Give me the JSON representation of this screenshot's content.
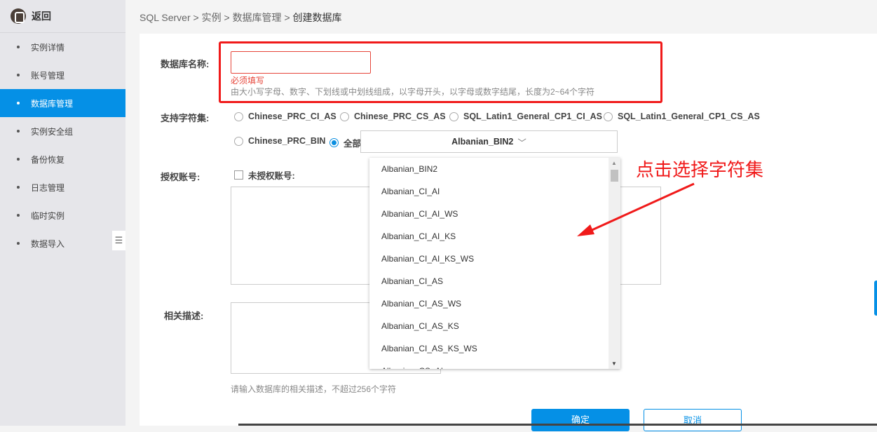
{
  "sidebar": {
    "back_label": "返回",
    "items": [
      {
        "label": "实例详情"
      },
      {
        "label": "账号管理"
      },
      {
        "label": "数据库管理",
        "active": true
      },
      {
        "label": "实例安全组"
      },
      {
        "label": "备份恢复"
      },
      {
        "label": "日志管理"
      },
      {
        "label": "临时实例"
      },
      {
        "label": "数据导入"
      }
    ]
  },
  "breadcrumb": {
    "items": [
      "SQL Server",
      "实例",
      "数据库管理"
    ],
    "current": "创建数据库",
    "sep": ">"
  },
  "form": {
    "name_label": "数据库名称:",
    "name_value": "",
    "name_error": "必须填写",
    "name_hint": "由大小写字母、数字、下划线或中划线组成，以字母开头，以字母或数字结尾，长度为2~64个字符",
    "charset_label": "支持字符集:",
    "charset_options": [
      "Chinese_PRC_CI_AS",
      "Chinese_PRC_CS_AS",
      "SQL_Latin1_General_CP1_CI_AS",
      "SQL_Latin1_General_CP1_CS_AS",
      "Chinese_PRC_BIN",
      "全部"
    ],
    "charset_selected": "全部",
    "charset_select_value": "Albanian_BIN2",
    "dropdown_options": [
      "Albanian_BIN2",
      "Albanian_CI_AI",
      "Albanian_CI_AI_WS",
      "Albanian_CI_AI_KS",
      "Albanian_CI_AI_KS_WS",
      "Albanian_CI_AS",
      "Albanian_CI_AS_WS",
      "Albanian_CI_AS_KS",
      "Albanian_CI_AS_KS_WS",
      "Albanian_CS_AI"
    ],
    "account_label": "授权账号:",
    "unauthorized_label": "未授权账号:",
    "desc_label": "相关描述:",
    "desc_hint": "请输入数据库的相关描述，不超过256个字符",
    "confirm": "确定",
    "cancel": "取消"
  },
  "annotation": "点击选择字符集",
  "colors": {
    "accent": "#0590e6",
    "annotation": "#f01a1a"
  }
}
